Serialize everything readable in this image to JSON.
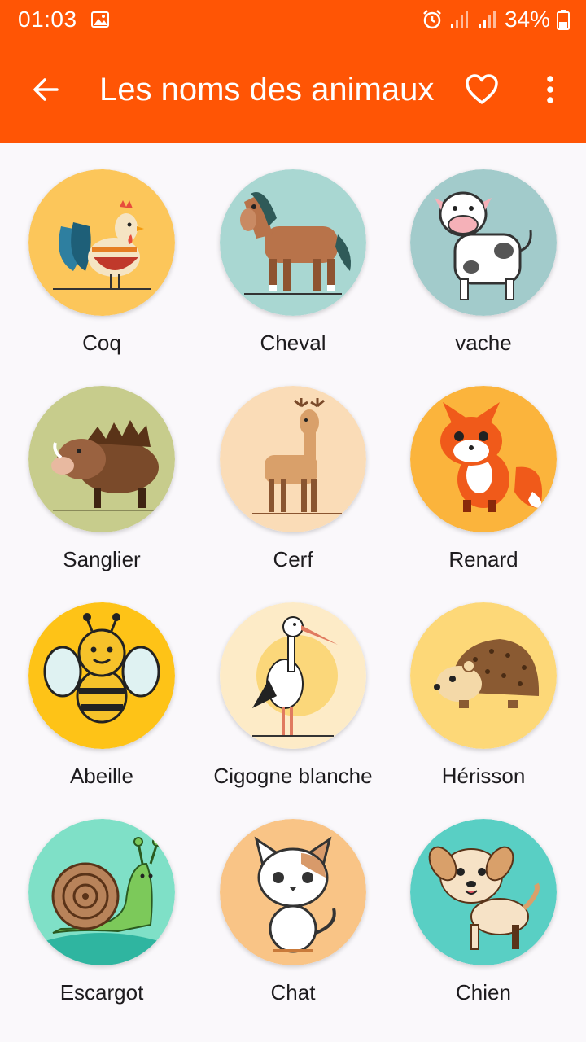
{
  "status_bar": {
    "time": "01:03",
    "battery": "34%",
    "icons": [
      "image-icon",
      "alarm-icon",
      "signal-icon",
      "signal-icon",
      "battery-icon"
    ]
  },
  "app_bar": {
    "title": "Les noms des animaux",
    "back_icon": "arrow-back-icon",
    "favorite_icon": "heart-outline-icon",
    "more_icon": "more-vert-icon",
    "background": "#ff5505"
  },
  "animals": [
    {
      "label": "Coq",
      "bg": "#fcc65a"
    },
    {
      "label": "Cheval",
      "bg": "#a9d7d2"
    },
    {
      "label": "vache",
      "bg": "#a2cbcb"
    },
    {
      "label": "Sanglier",
      "bg": "#c7cc8c"
    },
    {
      "label": "Cerf",
      "bg": "#fadcb7"
    },
    {
      "label": "Renard",
      "bg": "#fbb43c"
    },
    {
      "label": "Abeille",
      "bg": "#fec317"
    },
    {
      "label": "Cigogne blanche",
      "bg": "#fdebc7"
    },
    {
      "label": "Hérisson",
      "bg": "#fdd878"
    },
    {
      "label": "Escargot",
      "bg": "#7fe0c7"
    },
    {
      "label": "Chat",
      "bg": "#f9c486"
    },
    {
      "label": "Chien",
      "bg": "#59cfc4"
    }
  ]
}
